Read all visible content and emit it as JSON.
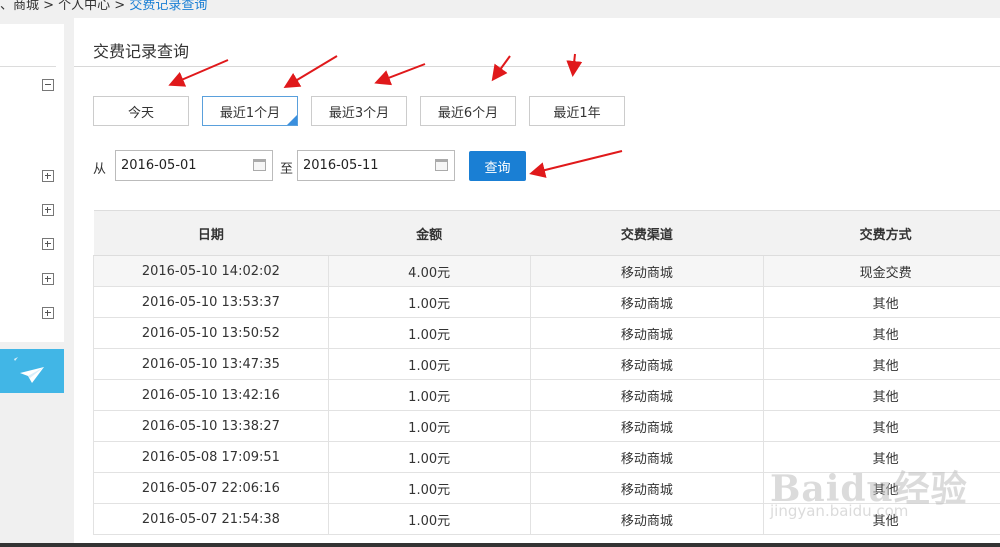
{
  "breadcrumb": {
    "prefix": "、商城 > 个人中心 > ",
    "current": "交费记录查询"
  },
  "sidebar": {
    "tree_icons": [
      "minus-icon",
      "plus-icon",
      "plus-icon",
      "plus-icon",
      "plus-icon",
      "plus-icon"
    ],
    "promo_icon": "paper-plane-icon"
  },
  "page": {
    "title": "交费记录查询"
  },
  "range_buttons": [
    "今天",
    "最近1个月",
    "最近3个月",
    "最近6个月",
    "最近1年"
  ],
  "active_range": "最近1个月",
  "filter": {
    "from_label": "从",
    "to_label": "至",
    "from_value": "2016-05-01",
    "to_value": "2016-05-11",
    "query_label": "查询"
  },
  "table": {
    "headers": [
      "日期",
      "金额",
      "交费渠道",
      "交费方式"
    ],
    "rows": [
      [
        "2016-05-10 14:02:02",
        "4.00元",
        "移动商城",
        "现金交费"
      ],
      [
        "2016-05-10 13:53:37",
        "1.00元",
        "移动商城",
        "其他"
      ],
      [
        "2016-05-10 13:50:52",
        "1.00元",
        "移动商城",
        "其他"
      ],
      [
        "2016-05-10 13:47:35",
        "1.00元",
        "移动商城",
        "其他"
      ],
      [
        "2016-05-10 13:42:16",
        "1.00元",
        "移动商城",
        "其他"
      ],
      [
        "2016-05-10 13:38:27",
        "1.00元",
        "移动商城",
        "其他"
      ],
      [
        "2016-05-08 17:09:51",
        "1.00元",
        "移动商城",
        "其他"
      ],
      [
        "2016-05-07 22:06:16",
        "1.00元",
        "移动商城",
        "其他"
      ],
      [
        "2016-05-07 21:54:38",
        "1.00元",
        "移动商城",
        "其他"
      ]
    ]
  },
  "watermark": {
    "main": "Baidu经验",
    "sub": "jingyan.baidu.com"
  },
  "colors": {
    "accent": "#1a7fd4",
    "promo": "#41b6e6",
    "arrow": "#e0191b"
  }
}
